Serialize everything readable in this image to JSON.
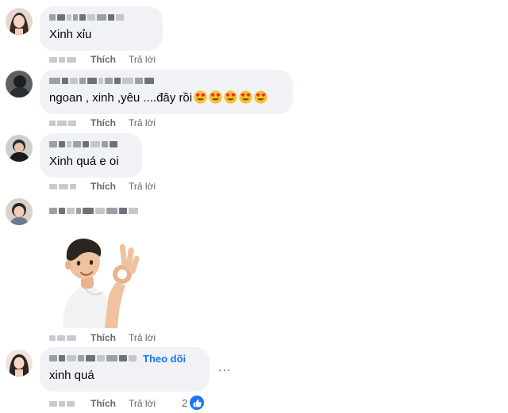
{
  "actions": {
    "like_label": "Thích",
    "reply_label": "Trả lời",
    "follow_label": "Theo dõi",
    "more_label": "..."
  },
  "comments": [
    {
      "text": "Xinh xỉu"
    },
    {
      "text": "ngoan , xinh ,yêu ....đây rồi",
      "emoji_count": 5,
      "emoji": "heart-eyes"
    },
    {
      "text": "Xinh quá e oi"
    },
    {
      "text": "",
      "attachment": "sticker-ok-hand-boy"
    },
    {
      "text": "xinh quá",
      "reaction_count": "2",
      "reaction": "like"
    }
  ],
  "colors": {
    "bubble": "#f0f2f5",
    "link": "#1877f2",
    "muted": "#65676b"
  }
}
